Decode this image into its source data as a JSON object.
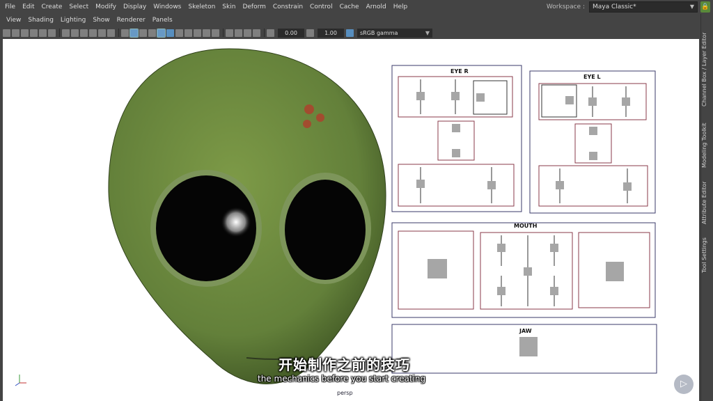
{
  "menubar": {
    "items": [
      "File",
      "Edit",
      "Create",
      "Select",
      "Modify",
      "Display",
      "Windows",
      "Skeleton",
      "Skin",
      "Deform",
      "Constrain",
      "Control",
      "Cache",
      "Arnold",
      "Help"
    ],
    "workspace_label": "Workspace :",
    "workspace_value": "Maya Classic*"
  },
  "panel_menu": {
    "items": [
      "View",
      "Shading",
      "Lighting",
      "Show",
      "Renderer",
      "Panels"
    ]
  },
  "toolbar": {
    "exposure": "0.00",
    "gamma_value": "1.00",
    "color_space": "sRGB gamma"
  },
  "right_tabs": [
    "Channel Box / Layer Editor",
    "Modeling Toolkit",
    "Attribute Editor",
    "Tool Settings"
  ],
  "viewport": {
    "camera_label": "persp",
    "controls": {
      "eye_r": "EYE R",
      "eye_l": "EYE L",
      "mouth": "MOUTH",
      "jaw": "JAW"
    }
  },
  "subtitles": {
    "chinese": "开始制作之前的技巧",
    "english": "the mechanics before you start creating"
  },
  "colors": {
    "alien_skin": "#6b8a3c",
    "control_outline": "#3a3a6a",
    "control_inner": "#8a3a4a",
    "handle": "#a6a6a6"
  }
}
